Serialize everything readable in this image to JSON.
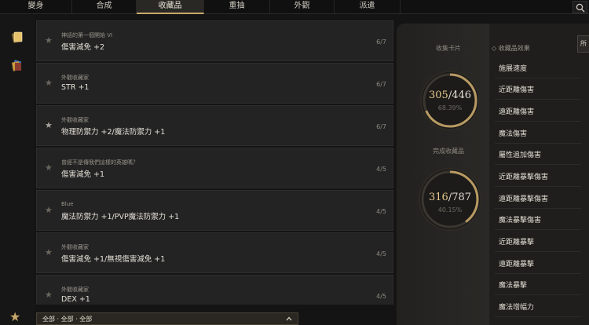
{
  "nav": {
    "tabs": [
      {
        "label": "變身"
      },
      {
        "label": "合成"
      },
      {
        "label": "收藏品",
        "active": true
      },
      {
        "label": "重抽"
      },
      {
        "label": "外觀"
      },
      {
        "label": "派遣"
      }
    ],
    "search_icon": "search-icon"
  },
  "rail": {
    "icons": [
      "card-icon",
      "books-icon"
    ],
    "star_icon": "star-icon"
  },
  "list": {
    "rows": [
      {
        "subtitle": "神話的第一個開始 VI",
        "effect": "傷害減免 +2",
        "count": "6/7",
        "starred": false
      },
      {
        "subtitle": "外觀收藏家",
        "effect": "STR +1",
        "count": "6/7",
        "starred": false
      },
      {
        "subtitle": "外觀收藏家",
        "effect": "物理防禦力 +2/魔法防禦力 +1",
        "count": "6/7",
        "starred": true
      },
      {
        "subtitle": "曾經不是傳我們這樣的英雄嗎？",
        "effect": "傷害減免 +1",
        "count": "4/5",
        "starred": false
      },
      {
        "subtitle": "Blue",
        "effect": "魔法防禦力 +1/PVP魔法防禦力 +1",
        "count": "4/5",
        "starred": false
      },
      {
        "subtitle": "外觀收藏家",
        "effect": "傷害減免 +1/無視傷害減免 +1",
        "count": "4/5",
        "starred": false
      },
      {
        "subtitle": "外觀收藏家",
        "effect": "DEX +1",
        "count": "4/5",
        "starred": false
      }
    ]
  },
  "filter": {
    "label": "全部 · 全部 · 全部",
    "chevron_icon": "chevron-up-icon"
  },
  "summary": {
    "cards": {
      "header": "收集卡片",
      "collected": "305",
      "total": "/446",
      "percent": "68.39%",
      "progress": 0.6839
    },
    "items": {
      "header": "完成收藏品",
      "collected": "316",
      "total": "/787",
      "percent": "40.15%",
      "progress": 0.4015
    }
  },
  "effects": {
    "header": "◇ 收藏品效果",
    "items": [
      "施展速度",
      "近距離傷害",
      "遠距離傷害",
      "魔法傷害",
      "屬性追加傷害",
      "近距離暴擊傷害",
      "遠距離暴擊傷害",
      "魔法暴擊傷害",
      "近距離暴擊",
      "遠距離暴擊",
      "魔法暴擊",
      "魔法增幅力"
    ]
  },
  "side_button": {
    "label": "所"
  },
  "colors": {
    "accent": "#c9a86a",
    "ring_track": "#3a3630",
    "ring_fill": "#b89a63"
  }
}
